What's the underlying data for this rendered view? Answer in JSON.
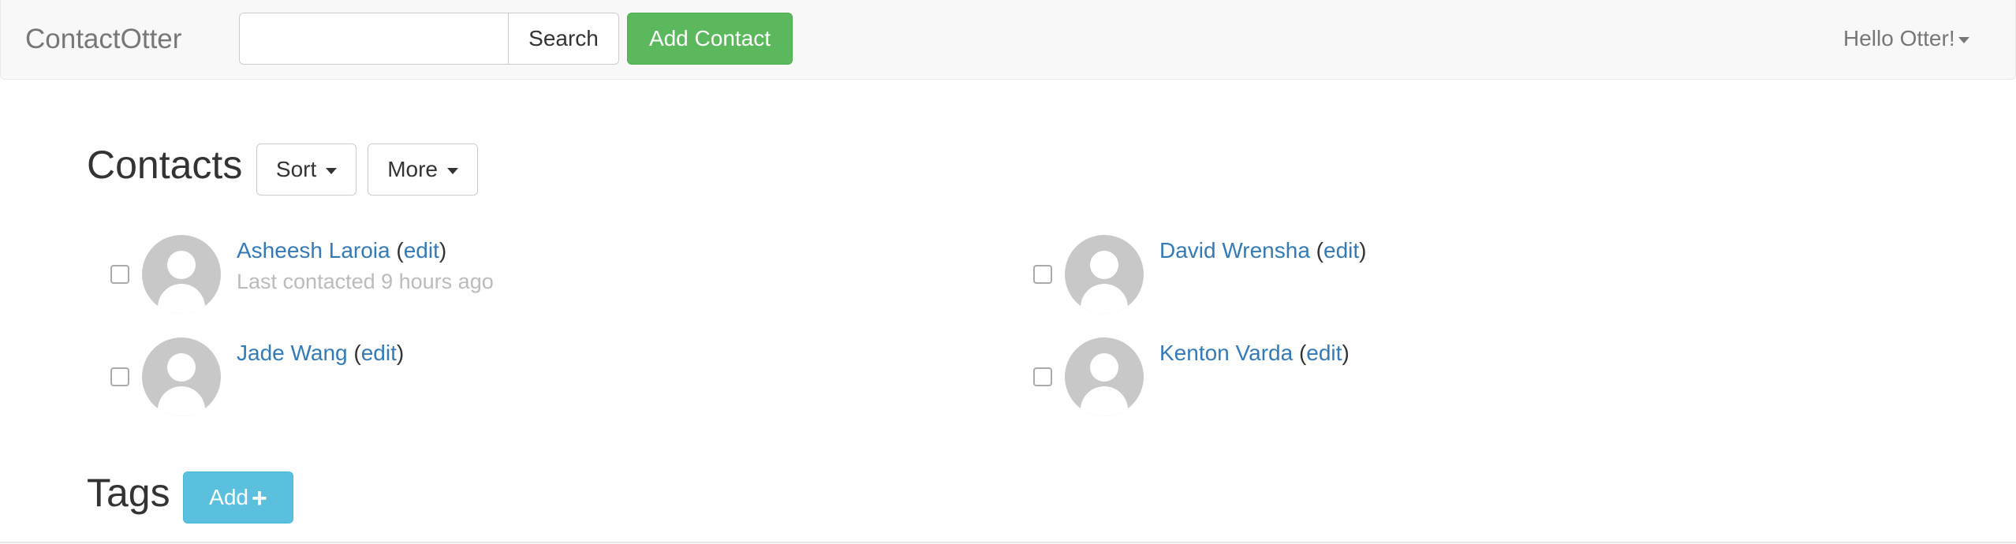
{
  "navbar": {
    "brand": "ContactOtter",
    "search": {
      "value": "",
      "placeholder": ""
    },
    "search_button": "Search",
    "add_contact_button": "Add Contact",
    "user_greeting": "Hello Otter!"
  },
  "contacts_section": {
    "heading": "Contacts",
    "sort_button": "Sort",
    "more_button": "More",
    "contacts": [
      {
        "name": "Asheesh Laroia",
        "edit_label": "edit",
        "last_contacted": "Last contacted 9 hours ago"
      },
      {
        "name": "David Wrensha",
        "edit_label": "edit",
        "last_contacted": ""
      },
      {
        "name": "Jade Wang",
        "edit_label": "edit",
        "last_contacted": ""
      },
      {
        "name": "Kenton Varda",
        "edit_label": "edit",
        "last_contacted": ""
      }
    ]
  },
  "tags_section": {
    "heading": "Tags",
    "add_button": "Add"
  },
  "colors": {
    "link": "#337ab7",
    "success": "#5cb85c",
    "info": "#5bc0de",
    "avatar": "#c8c8c8"
  },
  "icons": [
    "caret-down-icon",
    "plus-icon",
    "avatar-placeholder-icon"
  ]
}
